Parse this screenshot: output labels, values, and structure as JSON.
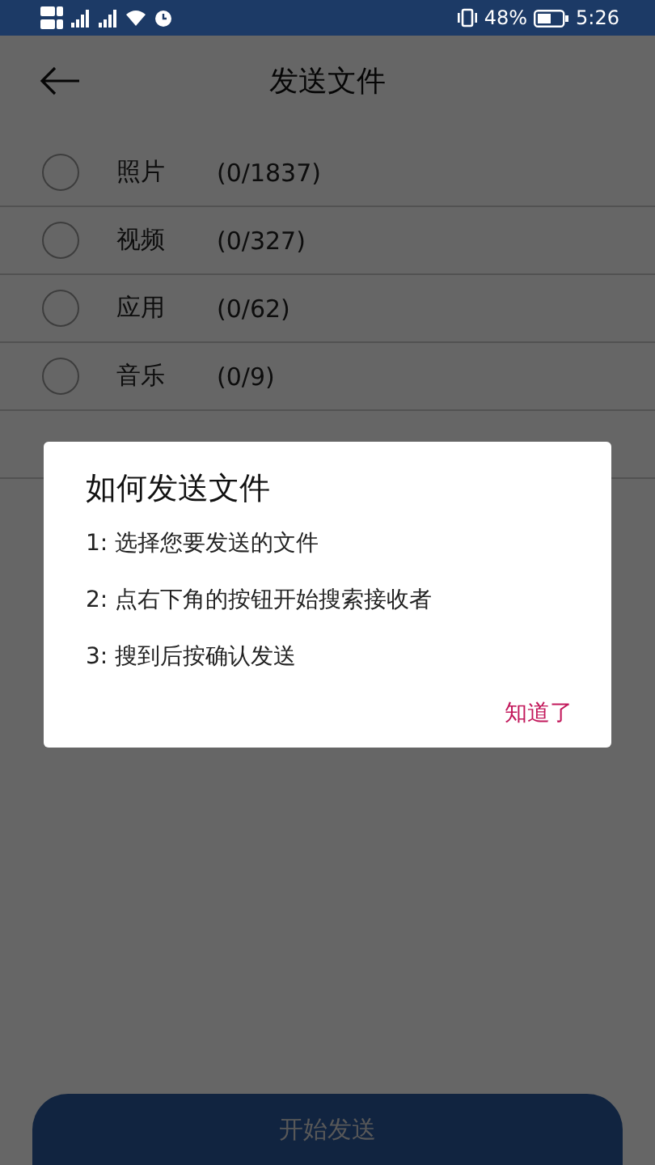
{
  "status_bar": {
    "battery": "48%",
    "time": "5:26"
  },
  "header": {
    "title": "发送文件"
  },
  "categories": [
    {
      "name": "照片",
      "count": "(0/1837)",
      "selected": false
    },
    {
      "name": "视频",
      "count": "(0/327)",
      "selected": false
    },
    {
      "name": "应用",
      "count": "(0/62)",
      "selected": false
    },
    {
      "name": "音乐",
      "count": "(0/9)",
      "selected": false
    }
  ],
  "dialog": {
    "title": "如何发送文件",
    "steps": [
      "1: 选择您要发送的文件",
      "2: 点右下角的按钮开始搜索接收者",
      "3: 搜到后按确认发送"
    ],
    "button": "知道了"
  },
  "send_button": "开始发送"
}
